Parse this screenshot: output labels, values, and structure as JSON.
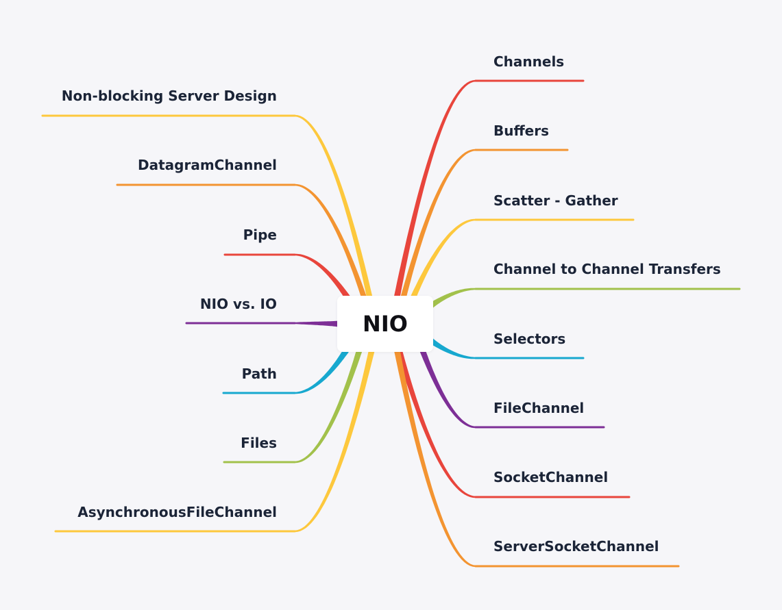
{
  "root": {
    "label": "NIO"
  },
  "colors": {
    "red": "#e8453c",
    "orange": "#f39431",
    "yellow": "#fdc83d",
    "green": "#a2c14b",
    "teal": "#17a8cf",
    "purple": "#7d2f96"
  },
  "left_branches": [
    {
      "label": "Non-blocking Server Design",
      "color": "#fdc83d"
    },
    {
      "label": "DatagramChannel",
      "color": "#f39431"
    },
    {
      "label": "Pipe",
      "color": "#e8453c"
    },
    {
      "label": "NIO vs. IO",
      "color": "#7d2f96"
    },
    {
      "label": "Path",
      "color": "#17a8cf"
    },
    {
      "label": "Files",
      "color": "#a2c14b"
    },
    {
      "label": "AsynchronousFileChannel",
      "color": "#fdc83d"
    }
  ],
  "right_branches": [
    {
      "label": "Channels",
      "color": "#e8453c"
    },
    {
      "label": "Buffers",
      "color": "#f39431"
    },
    {
      "label": "Scatter - Gather",
      "color": "#fdc83d"
    },
    {
      "label": "Channel to Channel Transfers",
      "color": "#a2c14b"
    },
    {
      "label": "Selectors",
      "color": "#17a8cf"
    },
    {
      "label": "FileChannel",
      "color": "#7d2f96"
    },
    {
      "label": "SocketChannel",
      "color": "#e8453c"
    },
    {
      "label": "ServerSocketChannel",
      "color": "#f39431"
    }
  ]
}
